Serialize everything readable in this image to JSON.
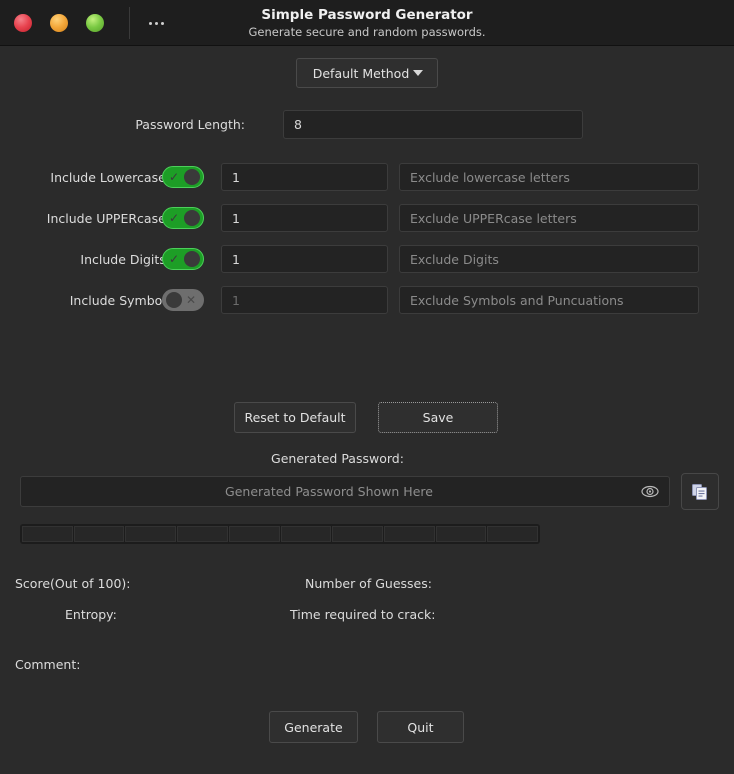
{
  "window": {
    "title": "Simple Password Generator",
    "subtitle": "Generate secure and random passwords.",
    "controls": {
      "close_icon": "close-circle-red",
      "minimize_icon": "minimize-circle-yellow",
      "maximize_icon": "maximize-circle-green",
      "menu_icon": "ellipsis-icon"
    },
    "background": "#2b2b2b",
    "titlebar_background": "#1e1e1e"
  },
  "method": {
    "selected": "Default Method",
    "caret_icon": "chevron-down-icon"
  },
  "password_length": {
    "label": "Password Length:",
    "value": "8"
  },
  "options": [
    {
      "label": "Include Lowercase:",
      "enabled": true,
      "toggle_state": "on",
      "toggle_icon": "check-icon",
      "count": "1",
      "exclude_placeholder": "Exclude lowercase letters",
      "exclude_value": ""
    },
    {
      "label": "Include UPPERcase:",
      "enabled": true,
      "toggle_state": "on",
      "toggle_icon": "check-icon",
      "count": "1",
      "exclude_placeholder": "Exclude UPPERcase letters",
      "exclude_value": ""
    },
    {
      "label": "Include Digits:",
      "enabled": true,
      "toggle_state": "on",
      "toggle_icon": "check-icon",
      "count": "1",
      "exclude_placeholder": "Exclude Digits",
      "exclude_value": ""
    },
    {
      "label": "Include Symbol:",
      "enabled": false,
      "toggle_state": "off",
      "toggle_icon": "cross-icon",
      "count": "1",
      "exclude_placeholder": "Exclude Symbols and Puncuations",
      "exclude_value": ""
    }
  ],
  "actions": {
    "reset": "Reset to Default",
    "save": "Save",
    "generate": "Generate",
    "quit": "Quit"
  },
  "generated": {
    "label": "Generated Password:",
    "placeholder": "Generated Password Shown Here",
    "value": "",
    "eye_icon": "eye-icon",
    "copy_icon": "copy-icon",
    "strength_segments": 10,
    "strength_filled": 0
  },
  "stats": {
    "score_label": "Score(Out of 100):",
    "score_value": "",
    "guesses_label": "Number of Guesses:",
    "guesses_value": "",
    "entropy_label": "Entropy:",
    "entropy_value": "",
    "crack_label": "Time required to crack:",
    "crack_value": "",
    "comment_label": "Comment:",
    "comment_value": ""
  },
  "colors": {
    "toggle_on": "#1d9e26",
    "toggle_off": "#6e6e6e",
    "accent_text": "#dcdcdc"
  }
}
